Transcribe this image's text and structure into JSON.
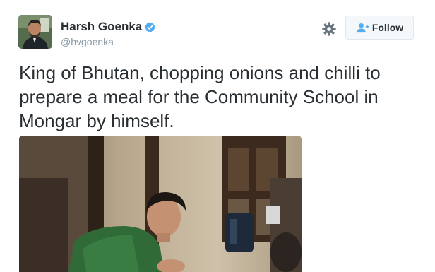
{
  "tweet": {
    "author": {
      "name": "Harsh Goenka",
      "handle": "@hvgoenka",
      "verified": true,
      "avatar_icon": "profile-photo"
    },
    "actions": {
      "settings_icon": "gear-icon",
      "follow_label": "Follow",
      "follow_icon": "add-user-icon",
      "accent_color": "#55acee"
    },
    "text": "King of Bhutan, chopping onions and chilli to prepare a meal for the Community School in Mongar by himself."
  }
}
